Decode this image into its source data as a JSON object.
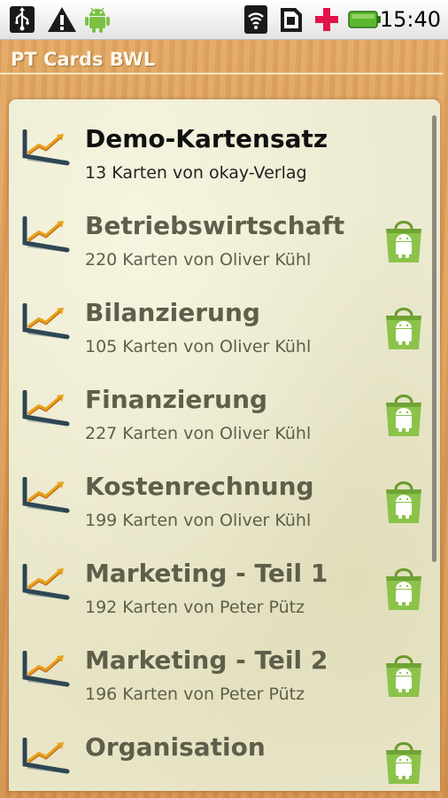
{
  "status_bar": {
    "time": "15:40",
    "icons": [
      "usb-icon",
      "warning-icon",
      "android-icon",
      "wifi-icon",
      "sim-icon",
      "medical-cross-icon",
      "battery-icon"
    ]
  },
  "app": {
    "title": "PT Cards BWL"
  },
  "colors": {
    "wood": "#d99a55",
    "panel": "#ecead0",
    "title_active": "#111111",
    "title_inactive": "#5e5e4a",
    "bag_green": "#8bc34a"
  },
  "card_sets": [
    {
      "title": "Demo-Kartensatz",
      "subtitle": "13 Karten von okay-Verlag",
      "active": true,
      "has_store_icon": false
    },
    {
      "title": "Betriebswirtschaft",
      "subtitle": "220 Karten von Oliver Kühl",
      "active": false,
      "has_store_icon": true
    },
    {
      "title": "Bilanzierung",
      "subtitle": "105 Karten von Oliver Kühl",
      "active": false,
      "has_store_icon": true
    },
    {
      "title": "Finanzierung",
      "subtitle": "227 Karten von Oliver Kühl",
      "active": false,
      "has_store_icon": true
    },
    {
      "title": "Kostenrechnung",
      "subtitle": "199 Karten von Oliver Kühl",
      "active": false,
      "has_store_icon": true
    },
    {
      "title": "Marketing - Teil 1",
      "subtitle": "192 Karten von Peter Pütz",
      "active": false,
      "has_store_icon": true
    },
    {
      "title": "Marketing - Teil 2",
      "subtitle": "196 Karten von Peter Pütz",
      "active": false,
      "has_store_icon": true
    },
    {
      "title": "Organisation",
      "subtitle": "",
      "active": false,
      "has_store_icon": true
    }
  ]
}
